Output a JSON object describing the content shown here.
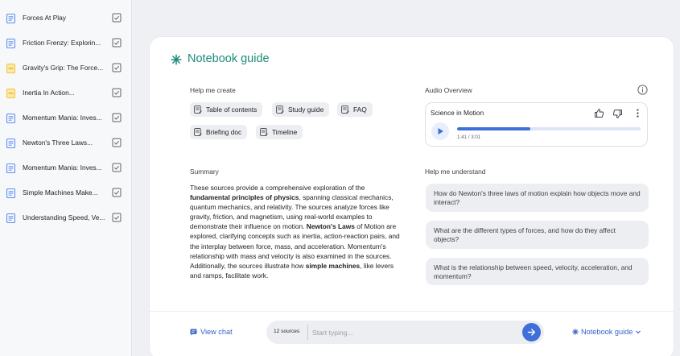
{
  "sources": [
    {
      "label": "Forces At Play",
      "icon": "document-icon",
      "color": "#5b8def"
    },
    {
      "label": "Friction Frenzy: Explorin...",
      "icon": "document-icon",
      "color": "#5b8def"
    },
    {
      "label": "Gravity's Grip: The Force...",
      "icon": "note-icon",
      "color": "#f3c53a"
    },
    {
      "label": "Inertia In Action...",
      "icon": "note-icon",
      "color": "#f3c53a"
    },
    {
      "label": "Momentum Mania: Inves...",
      "icon": "document-icon",
      "color": "#5b8def"
    },
    {
      "label": "Newton's Three Laws...",
      "icon": "document-icon",
      "color": "#5b8def"
    },
    {
      "label": "Momentum Mania: Inves...",
      "icon": "document-icon",
      "color": "#5b8def"
    },
    {
      "label": "Simple Machines Make...",
      "icon": "document-icon",
      "color": "#5b8def"
    },
    {
      "label": "Understanding Speed, Ve...",
      "icon": "document-icon",
      "color": "#5b8def"
    }
  ],
  "guide": {
    "title": "Notebook guide",
    "help_create_label": "Help me create",
    "chips": [
      "Table of contents",
      "Study guide",
      "FAQ",
      "Briefing doc",
      "Timeline"
    ],
    "audio_label": "Audio Overview",
    "audio": {
      "title": "Science in Motion",
      "time": "1:41 / 3:01",
      "progress": 0.397
    },
    "summary_label": "Summary",
    "summary": {
      "p1": "These sources provide a comprehensive exploration of the ",
      "b1": "fundamental principles of physics",
      "p2": ", spanning classical mechanics, quantum mechanics, and relativity. The sources analyze forces like gravity, friction, and magnetism, using real-world examples to demonstrate their influence on motion. ",
      "b2": "Newton's Laws",
      "p3": " of Motion are explored, clarifying concepts such as inertia, action-reaction pairs, and the interplay between force, mass, and acceleration. Momentum's relationship with mass and velocity is also examined in the sources. Additionally, the sources illustrate how ",
      "b3": "simple machines",
      "p4": ", like levers and ramps, facilitate work."
    },
    "understand_label": "Help me understand",
    "questions": [
      "How do Newton's three laws of motion explain how objects move and interact?",
      "What are the different types of forces, and how do they affect objects?",
      "What is the relationship between speed, velocity, acceleration, and momentum?"
    ]
  },
  "bottom": {
    "view_chat": "View chat",
    "source_count": "12 sources",
    "placeholder": "Start typing...",
    "notebook_guide": "Notebook guide"
  },
  "colors": {
    "accent": "#1a8c7a",
    "link": "#3761c9",
    "send": "#3f6fd8"
  }
}
